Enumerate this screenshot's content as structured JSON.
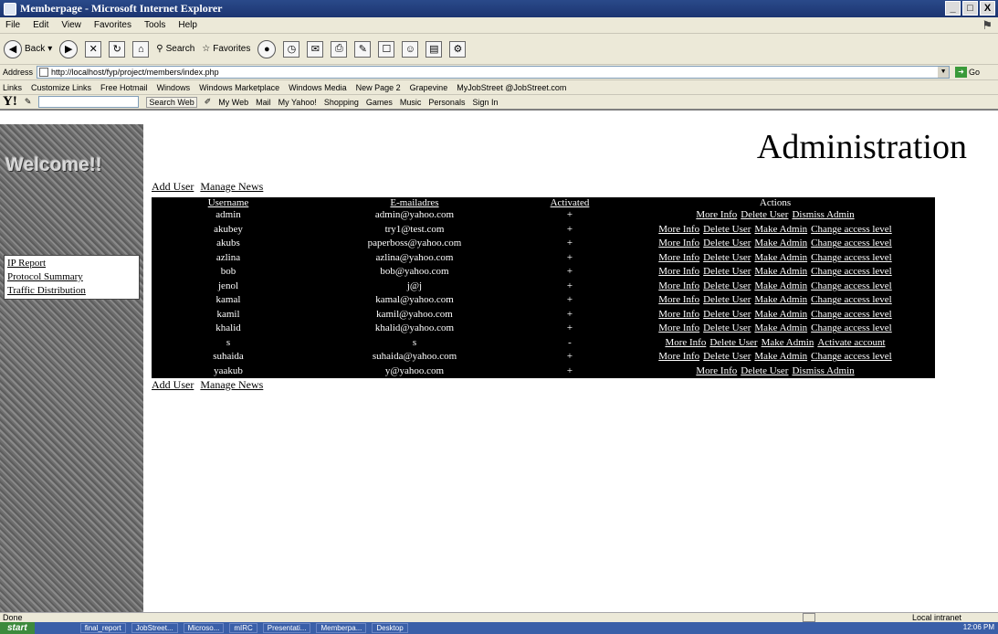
{
  "window": {
    "title": "Memberpage - Microsoft Internet Explorer",
    "buttons": [
      "_",
      "□",
      "X"
    ]
  },
  "menu": [
    "File",
    "Edit",
    "View",
    "Favorites",
    "Tools",
    "Help"
  ],
  "toolbar": {
    "back": "Back",
    "search": "Search",
    "favorites": "Favorites"
  },
  "address": {
    "label": "Address",
    "url": "http://localhost/fyp/project/members/index.php",
    "go": "Go"
  },
  "links": {
    "label": "Links",
    "items": [
      "Customize Links",
      "Free Hotmail",
      "Windows",
      "Windows Marketplace",
      "Windows Media",
      "New Page 2",
      "Grapevine",
      "MyJobStreet @JobStreet.com"
    ]
  },
  "yahoo": {
    "logo": "Y!",
    "search_button": "Search Web",
    "items": [
      "My Web",
      "Mail",
      "My Yahoo!",
      "Shopping",
      "Games",
      "Music",
      "Personals",
      "Sign In"
    ]
  },
  "sidebar": {
    "welcome": "Welcome!!",
    "menu_items": [
      "IP Report",
      "Protocol Summary",
      "Traffic Distribution"
    ]
  },
  "page": {
    "title": "Administration",
    "top_links": [
      "Add User",
      "Manage News"
    ],
    "bottom_links": [
      "Add User",
      "Manage News"
    ]
  },
  "table": {
    "headers": [
      "Username",
      "E-mailadres",
      "Activated",
      "Actions"
    ],
    "rows": [
      {
        "username": "admin",
        "email": "admin@yahoo.com",
        "activated": "+",
        "actions": [
          "More Info",
          "Delete User",
          "Dismiss Admin"
        ]
      },
      {
        "username": "akubey",
        "email": "try1@test.com",
        "activated": "+",
        "actions": [
          "More Info",
          "Delete User",
          "Make Admin",
          "Change access level"
        ]
      },
      {
        "username": "akubs",
        "email": "paperboss@yahoo.com",
        "activated": "+",
        "actions": [
          "More Info",
          "Delete User",
          "Make Admin",
          "Change access level"
        ]
      },
      {
        "username": "azlina",
        "email": "azlina@yahoo.com",
        "activated": "+",
        "actions": [
          "More Info",
          "Delete User",
          "Make Admin",
          "Change access level"
        ]
      },
      {
        "username": "bob",
        "email": "bob@yahoo.com",
        "activated": "+",
        "actions": [
          "More Info",
          "Delete User",
          "Make Admin",
          "Change access level"
        ]
      },
      {
        "username": "jenol",
        "email": "j@j",
        "activated": "+",
        "actions": [
          "More Info",
          "Delete User",
          "Make Admin",
          "Change access level"
        ]
      },
      {
        "username": "kamal",
        "email": "kamal@yahoo.com",
        "activated": "+",
        "actions": [
          "More Info",
          "Delete User",
          "Make Admin",
          "Change access level"
        ]
      },
      {
        "username": "kamil",
        "email": "kamil@yahoo.com",
        "activated": "+",
        "actions": [
          "More Info",
          "Delete User",
          "Make Admin",
          "Change access level"
        ]
      },
      {
        "username": "khalid",
        "email": "khalid@yahoo.com",
        "activated": "+",
        "actions": [
          "More Info",
          "Delete User",
          "Make Admin",
          "Change access level"
        ]
      },
      {
        "username": "s",
        "email": "s",
        "activated": "-",
        "actions": [
          "More Info",
          "Delete User",
          "Make Admin",
          "Activate account"
        ]
      },
      {
        "username": "suhaida",
        "email": "suhaida@yahoo.com",
        "activated": "+",
        "actions": [
          "More Info",
          "Delete User",
          "Make Admin",
          "Change access level"
        ]
      },
      {
        "username": "yaakub",
        "email": "y@yahoo.com",
        "activated": "+",
        "actions": [
          "More Info",
          "Delete User",
          "Dismiss Admin"
        ]
      }
    ]
  },
  "status": {
    "text": "Done",
    "zone": "Local intranet"
  },
  "taskbar": {
    "start": "start",
    "tasks": [
      "final_report",
      "JobStreet...",
      "Microso...",
      "mIRC",
      "Presentati...",
      "Memberpa...",
      "Desktop"
    ],
    "clock": "12:06 PM"
  }
}
